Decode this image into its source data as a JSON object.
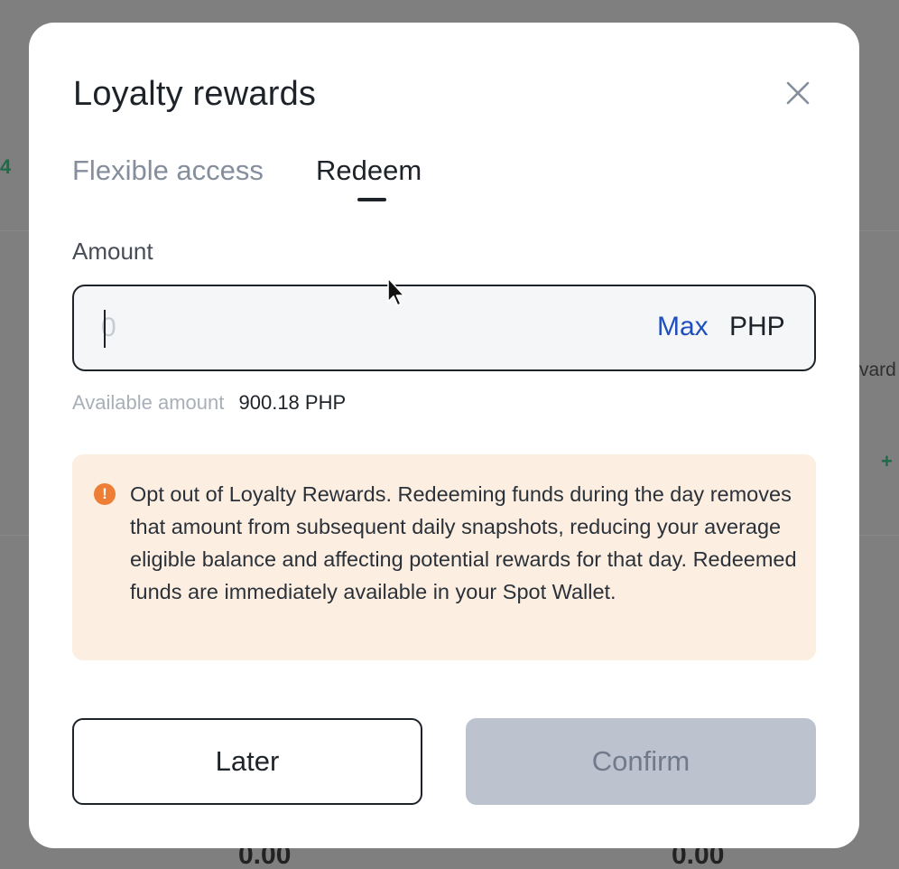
{
  "background": {
    "left_fragment": "4",
    "right_fragment": "vard",
    "plus_sign": "+",
    "bottom_values": [
      "0.00",
      "0.00"
    ]
  },
  "modal": {
    "title": "Loyalty rewards",
    "tabs": [
      {
        "label": "Flexible access",
        "active": false
      },
      {
        "label": "Redeem",
        "active": true
      }
    ],
    "amount": {
      "label": "Amount",
      "value": "",
      "placeholder": "0",
      "max_label": "Max",
      "currency": "PHP"
    },
    "available": {
      "label": "Available amount",
      "value": "900.18 PHP"
    },
    "warning": {
      "icon": "exclamation-icon",
      "text": "Opt out of Loyalty Rewards. Redeeming funds during the day removes that amount from subsequent daily snapshots, reducing your average eligible balance and affecting potential rewards for that day. Redeemed funds are immediately available in your Spot Wallet."
    },
    "buttons": {
      "later": "Later",
      "confirm": "Confirm"
    }
  },
  "colors": {
    "accent_blue": "#1f4fbf",
    "warning_bg": "#fcefe2",
    "warning_icon": "#ee7d35",
    "disabled_button": "#bcc3cf"
  }
}
